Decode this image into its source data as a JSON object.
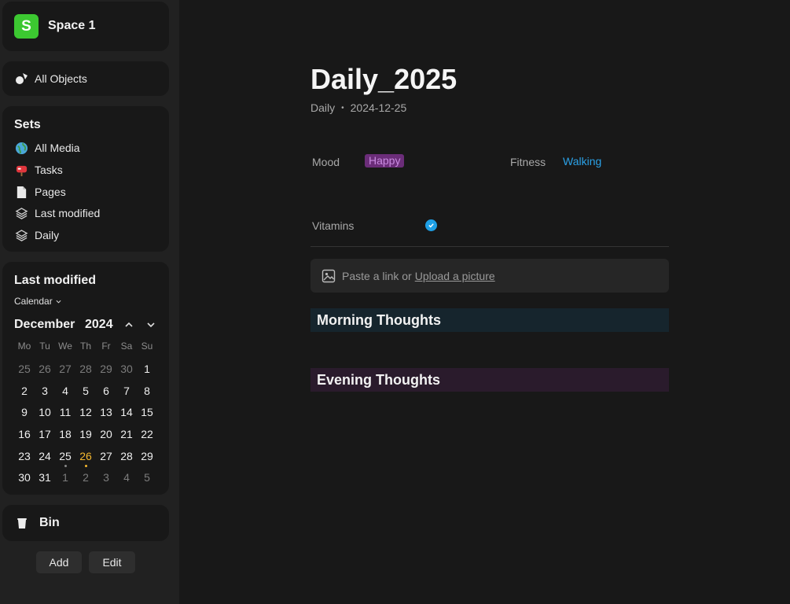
{
  "space": {
    "logo_letter": "S",
    "name": "Space 1",
    "accent": "#3cc831"
  },
  "nav": {
    "all_objects": "All Objects"
  },
  "sets": {
    "title": "Sets",
    "items": [
      {
        "label": "All Media",
        "icon": "globe-icon"
      },
      {
        "label": "Tasks",
        "icon": "mailbox-icon"
      },
      {
        "label": "Pages",
        "icon": "page-icon"
      },
      {
        "label": "Last modified",
        "icon": "layers-icon"
      },
      {
        "label": "Daily",
        "icon": "layers-icon"
      }
    ]
  },
  "last_modified": {
    "title": "Last modified",
    "view": "Calendar",
    "month": "December",
    "year": "2024",
    "weekdays": [
      "Mo",
      "Tu",
      "We",
      "Th",
      "Fr",
      "Sa",
      "Su"
    ],
    "weeks": [
      [
        "25",
        "26",
        "27",
        "28",
        "29",
        "30",
        "1"
      ],
      [
        "2",
        "3",
        "4",
        "5",
        "6",
        "7",
        "8"
      ],
      [
        "9",
        "10",
        "11",
        "12",
        "13",
        "14",
        "15"
      ],
      [
        "16",
        "17",
        "18",
        "19",
        "20",
        "21",
        "22"
      ],
      [
        "23",
        "24",
        "25",
        "26",
        "27",
        "28",
        "29"
      ],
      [
        "30",
        "31",
        "1",
        "2",
        "3",
        "4",
        "5"
      ]
    ],
    "today_color": "#f5b82e"
  },
  "bin": {
    "label": "Bin"
  },
  "footer": {
    "add_label": "Add",
    "edit_label": "Edit"
  },
  "document": {
    "title": "Daily_2025",
    "type": "Daily",
    "bullet": "•",
    "date": "2024-12-25",
    "relations": {
      "mood_label": "Mood",
      "mood_value": "Happy",
      "fitness_label": "Fitness",
      "fitness_value": "Walking",
      "vitamins_label": "Vitamins",
      "vitamins_checked": true
    },
    "picture": {
      "prompt": "Paste a link or",
      "upload": "Upload a picture"
    },
    "blocks": [
      "Morning Thoughts",
      "Evening Thoughts"
    ]
  }
}
